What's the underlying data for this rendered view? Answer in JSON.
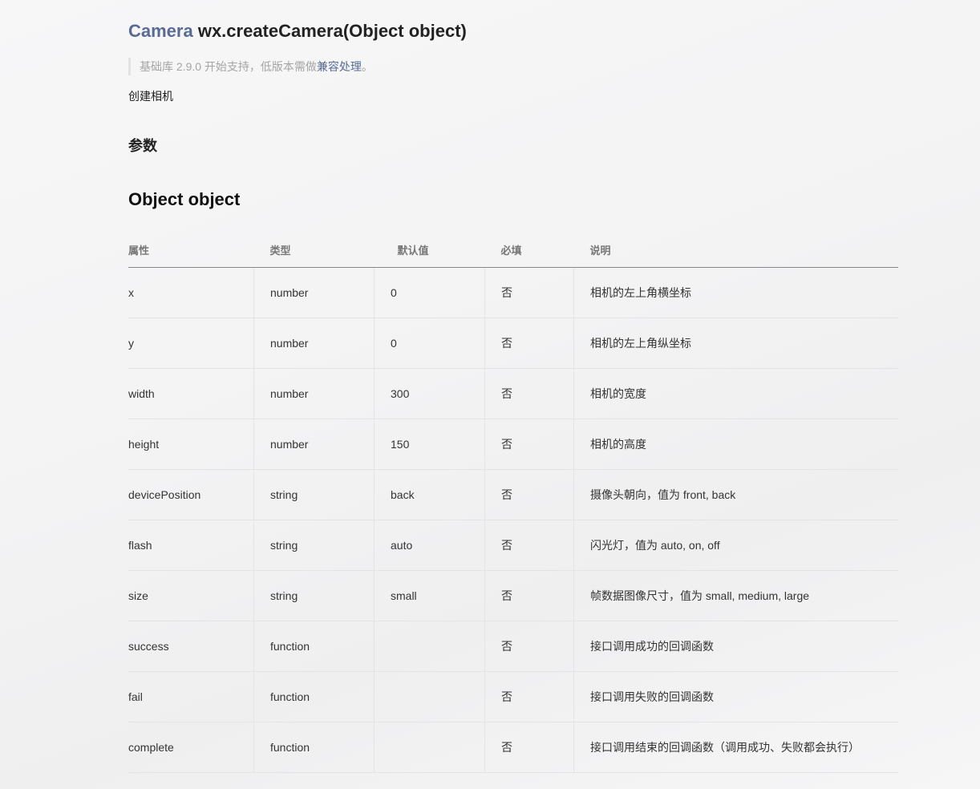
{
  "header": {
    "title_prefix": "Camera",
    "title_main": " wx.createCamera(Object object)"
  },
  "notice": {
    "text_before": "基础库 2.9.0 开始支持，低版本需做",
    "link": "兼容处理",
    "text_after": "。"
  },
  "description": "创建相机",
  "section_params": "参数",
  "section_object": "Object object",
  "table": {
    "columns": [
      "属性",
      "类型",
      "默认值",
      "必填",
      "说明"
    ],
    "rows": [
      {
        "name": "x",
        "type": "number",
        "default": "0",
        "required": "否",
        "desc": "相机的左上角横坐标"
      },
      {
        "name": "y",
        "type": "number",
        "default": "0",
        "required": "否",
        "desc": "相机的左上角纵坐标"
      },
      {
        "name": "width",
        "type": "number",
        "default": "300",
        "required": "否",
        "desc": "相机的宽度"
      },
      {
        "name": "height",
        "type": "number",
        "default": "150",
        "required": "否",
        "desc": "相机的高度"
      },
      {
        "name": "devicePosition",
        "type": "string",
        "default": "back",
        "required": "否",
        "desc": "摄像头朝向，值为 front, back"
      },
      {
        "name": "flash",
        "type": "string",
        "default": "auto",
        "required": "否",
        "desc": "闪光灯，值为 auto, on, off"
      },
      {
        "name": "size",
        "type": "string",
        "default": "small",
        "required": "否",
        "desc": "帧数据图像尺寸，值为 small, medium, large"
      },
      {
        "name": "success",
        "type": "function",
        "default": "",
        "required": "否",
        "desc": "接口调用成功的回调函数"
      },
      {
        "name": "fail",
        "type": "function",
        "default": "",
        "required": "否",
        "desc": "接口调用失败的回调函数"
      },
      {
        "name": "complete",
        "type": "function",
        "default": "",
        "required": "否",
        "desc": "接口调用结束的回调函数（调用成功、失败都会执行）"
      }
    ]
  },
  "colors": {
    "link": "#576b95",
    "text": "#222222",
    "muted": "#a5a5a5"
  }
}
